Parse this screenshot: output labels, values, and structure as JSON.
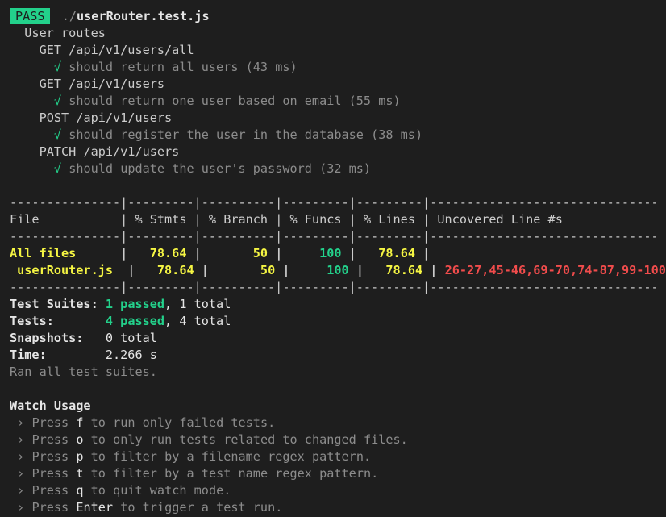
{
  "header": {
    "badge": "PASS",
    "path_dir": " ./",
    "path_file": "userRouter.test.js"
  },
  "suite": {
    "name": "User routes",
    "groups": [
      {
        "route": "GET /api/v1/users/all",
        "check": "√",
        "test": "should return all users (43 ms)"
      },
      {
        "route": "GET /api/v1/users",
        "check": "√",
        "test": "should return one user based on email (55 ms)"
      },
      {
        "route": "POST /api/v1/users",
        "check": "√",
        "test": "should register the user in the database (38 ms)"
      },
      {
        "route": "PATCH /api/v1/users",
        "check": "√",
        "test": "should update the user's password (32 ms)"
      }
    ]
  },
  "coverage": {
    "separator": "---------------|---------|----------|---------|---------|-------------------------------",
    "headers": [
      "File",
      "% Stmts",
      "% Branch",
      "% Funcs",
      "% Lines",
      "Uncovered Line #s"
    ],
    "rows": [
      {
        "file": "All files",
        "stmts": "78.64",
        "branch": "50",
        "funcs": "100",
        "lines": "78.64",
        "uncovered": ""
      },
      {
        "file": " userRouter.js",
        "stmts": "78.64",
        "branch": "50",
        "funcs": "100",
        "lines": "78.64",
        "uncovered": "26-27,45-46,69-70,74-87,99-100"
      }
    ]
  },
  "summary": {
    "suites_label": "Test Suites:",
    "suites_passed": "1 passed",
    "suites_total": ", 1 total",
    "tests_label": "Tests:",
    "tests_passed": "4 passed",
    "tests_total": ", 4 total",
    "snapshots_label": "Snapshots:",
    "snapshots_value": "0 total",
    "time_label": "Time:",
    "time_value": "2.266 s",
    "ran_all": "Ran all test suites."
  },
  "watch": {
    "title": "Watch Usage",
    "arrow": "›",
    "items": [
      {
        "pre": "Press ",
        "key": "f",
        "post": " to run only failed tests."
      },
      {
        "pre": "Press ",
        "key": "o",
        "post": " to only run tests related to changed files."
      },
      {
        "pre": "Press ",
        "key": "p",
        "post": " to filter by a filename regex pattern."
      },
      {
        "pre": "Press ",
        "key": "t",
        "post": " to filter by a test name regex pattern."
      },
      {
        "pre": "Press ",
        "key": "q",
        "post": " to quit watch mode."
      },
      {
        "pre": "Press ",
        "key": "Enter",
        "post": " to trigger a test run."
      }
    ]
  },
  "colors": {
    "background": "#1e1e1e",
    "pass_green": "#23d18b",
    "coverage_yellow": "#f5f543",
    "uncovered_red": "#f14c4c"
  }
}
